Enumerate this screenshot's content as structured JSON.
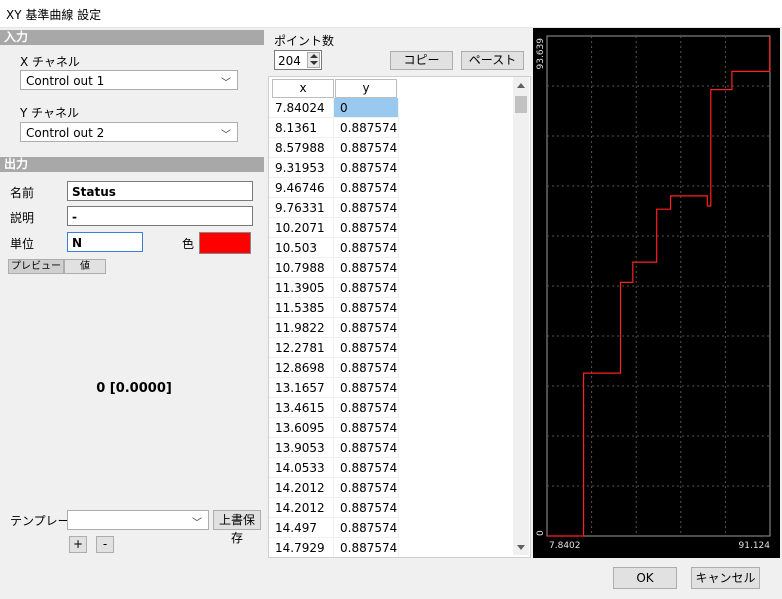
{
  "window": {
    "title": "XY 基準曲線 設定"
  },
  "input_section": {
    "header": "入力",
    "x_channel_label": "X チャネル",
    "x_channel_value": "Control out 1",
    "y_channel_label": "Y チャネル",
    "y_channel_value": "Control out 2"
  },
  "output_section": {
    "header": "出力",
    "name_label": "名前",
    "name_value": "Status",
    "desc_label": "説明",
    "desc_value": "-",
    "unit_label": "単位",
    "unit_value": "N",
    "color_label": "色",
    "color_value": "#ff0000",
    "tabs": [
      "プレビュー",
      "値"
    ],
    "preview_value": "0 [0.0000]"
  },
  "template": {
    "label": "テンプレート",
    "value": "",
    "overwrite_label": "上書保存",
    "add_label": "+",
    "remove_label": "-"
  },
  "points": {
    "label": "ポイント数",
    "count": "204",
    "copy_label": "コピー",
    "paste_label": "ペースト",
    "columns": [
      "x",
      "y"
    ],
    "rows": [
      [
        "7.84024",
        "0"
      ],
      [
        "8.1361",
        "0.887574"
      ],
      [
        "8.57988",
        "0.887574"
      ],
      [
        "9.31953",
        "0.887574"
      ],
      [
        "9.46746",
        "0.887574"
      ],
      [
        "9.76331",
        "0.887574"
      ],
      [
        "10.2071",
        "0.887574"
      ],
      [
        "10.503",
        "0.887574"
      ],
      [
        "10.7988",
        "0.887574"
      ],
      [
        "11.3905",
        "0.887574"
      ],
      [
        "11.5385",
        "0.887574"
      ],
      [
        "11.9822",
        "0.887574"
      ],
      [
        "12.2781",
        "0.887574"
      ],
      [
        "12.8698",
        "0.887574"
      ],
      [
        "13.1657",
        "0.887574"
      ],
      [
        "13.4615",
        "0.887574"
      ],
      [
        "13.6095",
        "0.887574"
      ],
      [
        "13.9053",
        "0.887574"
      ],
      [
        "14.0533",
        "0.887574"
      ],
      [
        "14.2012",
        "0.887574"
      ],
      [
        "14.2012",
        "0.887574"
      ],
      [
        "14.497",
        "0.887574"
      ],
      [
        "14.7929",
        "0.887574"
      ]
    ]
  },
  "chart_data": {
    "type": "line",
    "xlim": [
      7.8402,
      91.124
    ],
    "ylim": [
      0,
      93.639
    ],
    "x_min_label": "7.8402",
    "x_max_label": "91.124",
    "y_min_label": "0",
    "y_max_label": "93.639",
    "grid": true,
    "line_color": "#ff2020",
    "series": [
      {
        "x": [
          7.84,
          21.5,
          21.5,
          35.3,
          35.3,
          39.9,
          39.9,
          48.8,
          48.8,
          54.0,
          54.0,
          67.7,
          67.7,
          69.0,
          69.0,
          76.9,
          76.9,
          91.0,
          91.0
        ],
        "y": [
          0,
          0,
          30.5,
          30.5,
          47.5,
          47.5,
          51.3,
          51.3,
          61.2,
          61.2,
          63.7,
          63.7,
          61.8,
          61.8,
          83.6,
          83.6,
          87.0,
          87.0,
          93.6
        ]
      }
    ]
  },
  "footer": {
    "ok_label": "OK",
    "cancel_label": "キャンセル"
  }
}
